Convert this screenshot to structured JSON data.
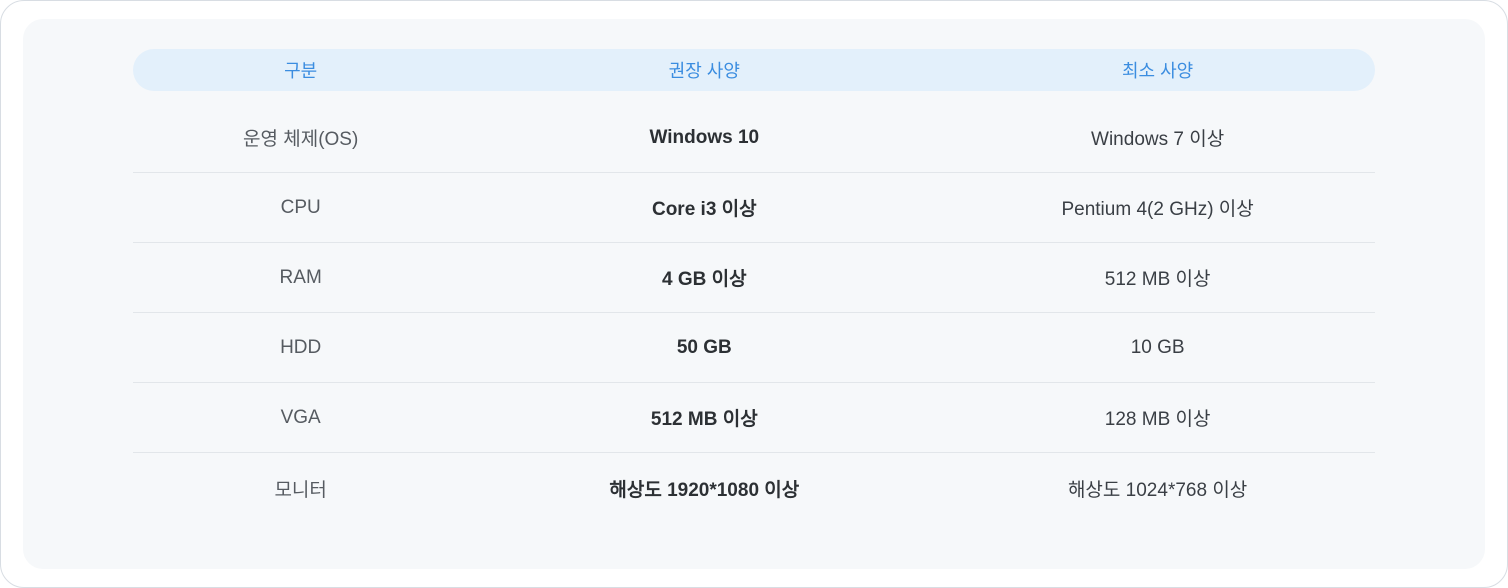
{
  "headers": {
    "category": "구분",
    "recommended": "권장 사양",
    "minimum": "최소 사양"
  },
  "rows": [
    {
      "label": "운영 체제(OS)",
      "recommended": "Windows 10",
      "minimum": "Windows 7 이상"
    },
    {
      "label": "CPU",
      "recommended": "Core i3 이상",
      "minimum": "Pentium 4(2 GHz) 이상"
    },
    {
      "label": "RAM",
      "recommended": "4 GB 이상",
      "minimum": "512 MB 이상"
    },
    {
      "label": "HDD",
      "recommended": "50 GB",
      "minimum": "10 GB"
    },
    {
      "label": "VGA",
      "recommended": "512 MB 이상",
      "minimum": "128 MB 이상"
    },
    {
      "label": "모니터",
      "recommended": "해상도 1920*1080 이상",
      "minimum": "해상도 1024*768 이상"
    }
  ]
}
